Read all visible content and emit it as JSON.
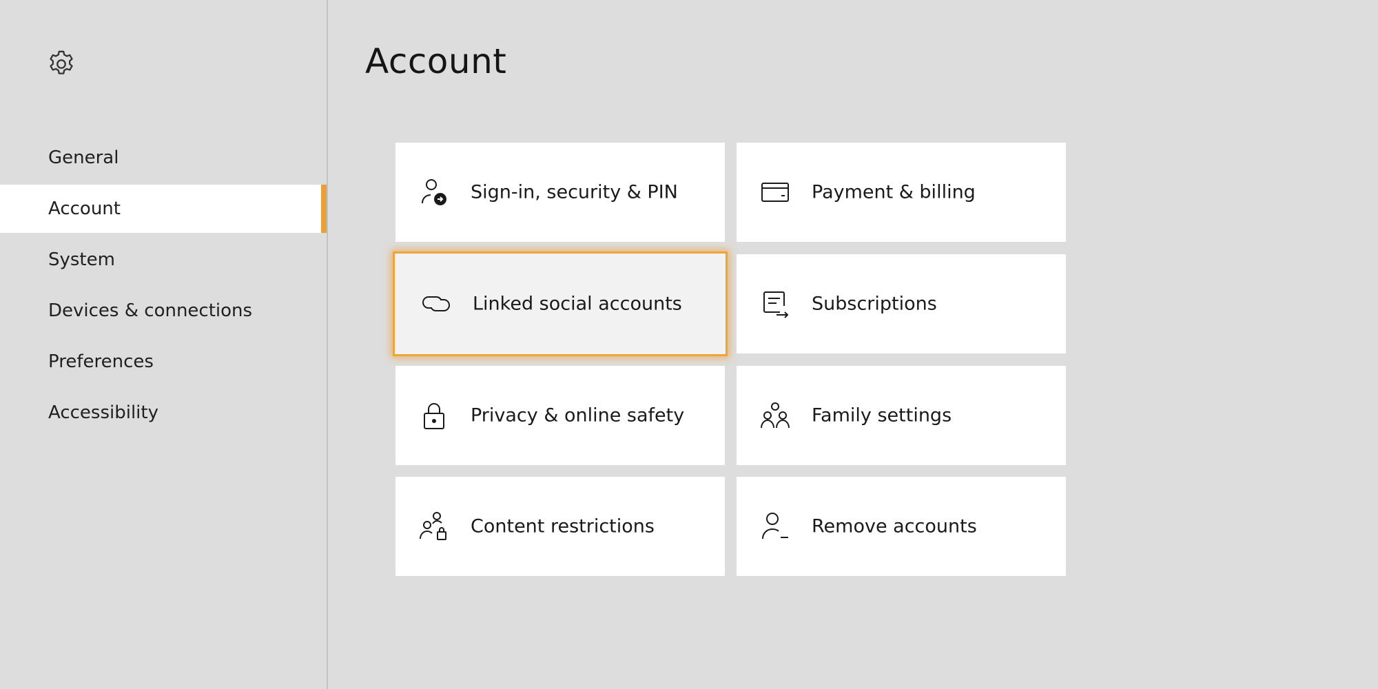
{
  "page": {
    "title": "Account"
  },
  "sidebar": {
    "icon": "gear-icon",
    "items": [
      {
        "label": "General"
      },
      {
        "label": "Account",
        "active": true
      },
      {
        "label": "System"
      },
      {
        "label": "Devices & connections"
      },
      {
        "label": "Preferences"
      },
      {
        "label": "Accessibility"
      }
    ]
  },
  "tiles": [
    {
      "label": "Sign-in, security & PIN",
      "icon": "person-sign-in-icon"
    },
    {
      "label": "Payment & billing",
      "icon": "credit-card-icon"
    },
    {
      "label": "Linked social accounts",
      "icon": "link-icon",
      "focused": true
    },
    {
      "label": "Subscriptions",
      "icon": "subscriptions-icon"
    },
    {
      "label": "Privacy & online safety",
      "icon": "lock-icon"
    },
    {
      "label": "Family settings",
      "icon": "family-icon"
    },
    {
      "label": "Content restrictions",
      "icon": "content-restrictions-icon"
    },
    {
      "label": "Remove accounts",
      "icon": "remove-person-icon"
    }
  ],
  "colors": {
    "background": "#dddddd",
    "tile": "#ffffff",
    "accent": "#e8a03a",
    "focus_glow": "#f0a33a"
  }
}
